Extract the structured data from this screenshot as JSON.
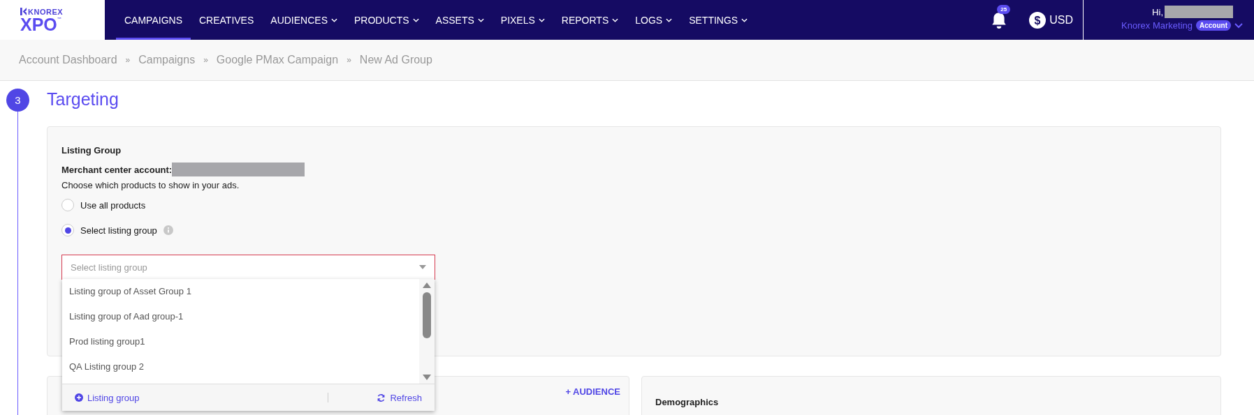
{
  "logo": {
    "brand": "KNOREX",
    "product": "XPO",
    "tm": "™"
  },
  "nav": [
    {
      "label": "CAMPAIGNS",
      "selected": true,
      "dropdown": false
    },
    {
      "label": "CREATIVES",
      "selected": false,
      "dropdown": false
    },
    {
      "label": "AUDIENCES",
      "selected": false,
      "dropdown": true
    },
    {
      "label": "PRODUCTS",
      "selected": false,
      "dropdown": true
    },
    {
      "label": "ASSETS",
      "selected": false,
      "dropdown": true
    },
    {
      "label": "PIXELS",
      "selected": false,
      "dropdown": true
    },
    {
      "label": "REPORTS",
      "selected": false,
      "dropdown": true
    },
    {
      "label": "LOGS",
      "selected": false,
      "dropdown": true
    },
    {
      "label": "SETTINGS",
      "selected": false,
      "dropdown": true
    }
  ],
  "notifications": {
    "count": "25"
  },
  "currency_symbol": "$",
  "currency": "USD",
  "user": {
    "greeting": "Hi,",
    "company": "Knorex Marketing",
    "badge": "Account"
  },
  "breadcrumb_separator": "»",
  "breadcrumb": [
    "Account Dashboard",
    "Campaigns",
    "Google PMax Campaign",
    "New Ad Group"
  ],
  "step": {
    "number": "3",
    "title": "Targeting"
  },
  "listing_group": {
    "title": "Listing Group",
    "merchant_label": "Merchant center account:",
    "hint": "Choose which products to show in your ads.",
    "options": [
      {
        "label": "Use all products",
        "selected": false,
        "info": false
      },
      {
        "label": "Select listing group",
        "selected": true,
        "info": true
      }
    ],
    "select": {
      "placeholder": "Select listing group",
      "invalid": true,
      "items": [
        "Listing group of Asset Group 1",
        "Listing group of Aad group-1",
        "Prod listing group1",
        "QA Listing group 2"
      ],
      "add_label": "Listing group",
      "refresh_label": "Refresh"
    }
  },
  "audience_button": "+ AUDIENCE",
  "demographics": {
    "title": "Demographics"
  }
}
